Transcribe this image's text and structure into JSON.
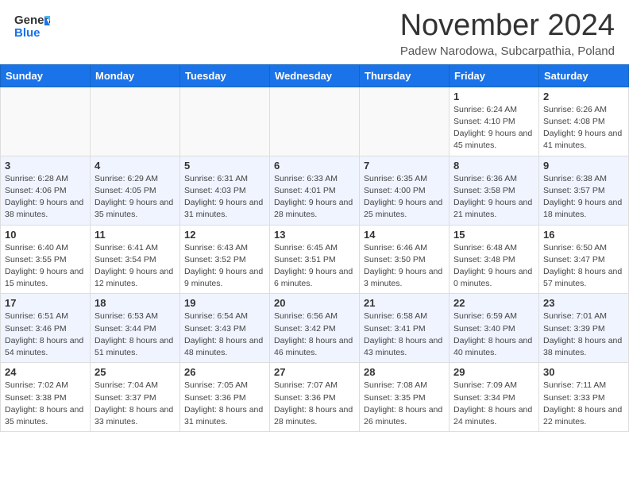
{
  "header": {
    "logo_general": "General",
    "logo_blue": "Blue",
    "month_title": "November 2024",
    "subtitle": "Padew Narodowa, Subcarpathia, Poland"
  },
  "calendar": {
    "days_of_week": [
      "Sunday",
      "Monday",
      "Tuesday",
      "Wednesday",
      "Thursday",
      "Friday",
      "Saturday"
    ],
    "weeks": [
      [
        {
          "day": "",
          "info": "",
          "empty": true
        },
        {
          "day": "",
          "info": "",
          "empty": true
        },
        {
          "day": "",
          "info": "",
          "empty": true
        },
        {
          "day": "",
          "info": "",
          "empty": true
        },
        {
          "day": "",
          "info": "",
          "empty": true
        },
        {
          "day": "1",
          "info": "Sunrise: 6:24 AM\nSunset: 4:10 PM\nDaylight: 9 hours and 45 minutes.",
          "empty": false
        },
        {
          "day": "2",
          "info": "Sunrise: 6:26 AM\nSunset: 4:08 PM\nDaylight: 9 hours and 41 minutes.",
          "empty": false
        }
      ],
      [
        {
          "day": "3",
          "info": "Sunrise: 6:28 AM\nSunset: 4:06 PM\nDaylight: 9 hours and 38 minutes.",
          "empty": false
        },
        {
          "day": "4",
          "info": "Sunrise: 6:29 AM\nSunset: 4:05 PM\nDaylight: 9 hours and 35 minutes.",
          "empty": false
        },
        {
          "day": "5",
          "info": "Sunrise: 6:31 AM\nSunset: 4:03 PM\nDaylight: 9 hours and 31 minutes.",
          "empty": false
        },
        {
          "day": "6",
          "info": "Sunrise: 6:33 AM\nSunset: 4:01 PM\nDaylight: 9 hours and 28 minutes.",
          "empty": false
        },
        {
          "day": "7",
          "info": "Sunrise: 6:35 AM\nSunset: 4:00 PM\nDaylight: 9 hours and 25 minutes.",
          "empty": false
        },
        {
          "day": "8",
          "info": "Sunrise: 6:36 AM\nSunset: 3:58 PM\nDaylight: 9 hours and 21 minutes.",
          "empty": false
        },
        {
          "day": "9",
          "info": "Sunrise: 6:38 AM\nSunset: 3:57 PM\nDaylight: 9 hours and 18 minutes.",
          "empty": false
        }
      ],
      [
        {
          "day": "10",
          "info": "Sunrise: 6:40 AM\nSunset: 3:55 PM\nDaylight: 9 hours and 15 minutes.",
          "empty": false
        },
        {
          "day": "11",
          "info": "Sunrise: 6:41 AM\nSunset: 3:54 PM\nDaylight: 9 hours and 12 minutes.",
          "empty": false
        },
        {
          "day": "12",
          "info": "Sunrise: 6:43 AM\nSunset: 3:52 PM\nDaylight: 9 hours and 9 minutes.",
          "empty": false
        },
        {
          "day": "13",
          "info": "Sunrise: 6:45 AM\nSunset: 3:51 PM\nDaylight: 9 hours and 6 minutes.",
          "empty": false
        },
        {
          "day": "14",
          "info": "Sunrise: 6:46 AM\nSunset: 3:50 PM\nDaylight: 9 hours and 3 minutes.",
          "empty": false
        },
        {
          "day": "15",
          "info": "Sunrise: 6:48 AM\nSunset: 3:48 PM\nDaylight: 9 hours and 0 minutes.",
          "empty": false
        },
        {
          "day": "16",
          "info": "Sunrise: 6:50 AM\nSunset: 3:47 PM\nDaylight: 8 hours and 57 minutes.",
          "empty": false
        }
      ],
      [
        {
          "day": "17",
          "info": "Sunrise: 6:51 AM\nSunset: 3:46 PM\nDaylight: 8 hours and 54 minutes.",
          "empty": false
        },
        {
          "day": "18",
          "info": "Sunrise: 6:53 AM\nSunset: 3:44 PM\nDaylight: 8 hours and 51 minutes.",
          "empty": false
        },
        {
          "day": "19",
          "info": "Sunrise: 6:54 AM\nSunset: 3:43 PM\nDaylight: 8 hours and 48 minutes.",
          "empty": false
        },
        {
          "day": "20",
          "info": "Sunrise: 6:56 AM\nSunset: 3:42 PM\nDaylight: 8 hours and 46 minutes.",
          "empty": false
        },
        {
          "day": "21",
          "info": "Sunrise: 6:58 AM\nSunset: 3:41 PM\nDaylight: 8 hours and 43 minutes.",
          "empty": false
        },
        {
          "day": "22",
          "info": "Sunrise: 6:59 AM\nSunset: 3:40 PM\nDaylight: 8 hours and 40 minutes.",
          "empty": false
        },
        {
          "day": "23",
          "info": "Sunrise: 7:01 AM\nSunset: 3:39 PM\nDaylight: 8 hours and 38 minutes.",
          "empty": false
        }
      ],
      [
        {
          "day": "24",
          "info": "Sunrise: 7:02 AM\nSunset: 3:38 PM\nDaylight: 8 hours and 35 minutes.",
          "empty": false
        },
        {
          "day": "25",
          "info": "Sunrise: 7:04 AM\nSunset: 3:37 PM\nDaylight: 8 hours and 33 minutes.",
          "empty": false
        },
        {
          "day": "26",
          "info": "Sunrise: 7:05 AM\nSunset: 3:36 PM\nDaylight: 8 hours and 31 minutes.",
          "empty": false
        },
        {
          "day": "27",
          "info": "Sunrise: 7:07 AM\nSunset: 3:36 PM\nDaylight: 8 hours and 28 minutes.",
          "empty": false
        },
        {
          "day": "28",
          "info": "Sunrise: 7:08 AM\nSunset: 3:35 PM\nDaylight: 8 hours and 26 minutes.",
          "empty": false
        },
        {
          "day": "29",
          "info": "Sunrise: 7:09 AM\nSunset: 3:34 PM\nDaylight: 8 hours and 24 minutes.",
          "empty": false
        },
        {
          "day": "30",
          "info": "Sunrise: 7:11 AM\nSunset: 3:33 PM\nDaylight: 8 hours and 22 minutes.",
          "empty": false
        }
      ]
    ]
  }
}
